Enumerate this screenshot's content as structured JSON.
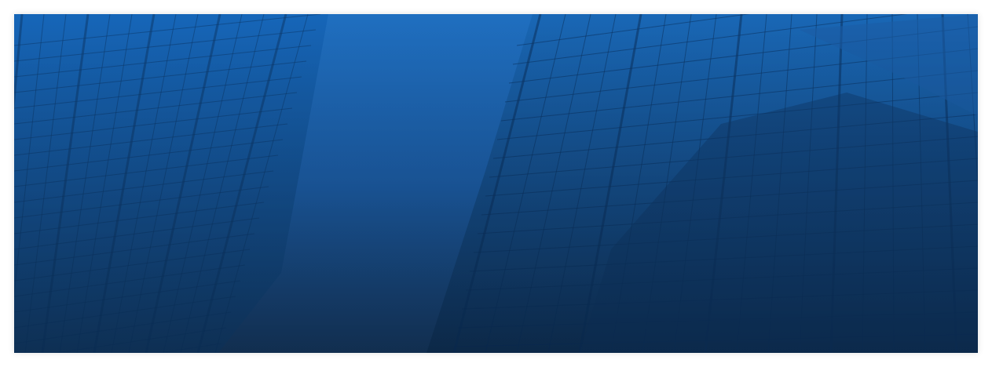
{
  "banner": {
    "image": "blue-tinted-skyscraper-glass-facades",
    "colors": {
      "top": "#1c6bbd",
      "bottom": "#163a63",
      "building_dark": "#0f3f78",
      "grid_line": "#0b3566"
    }
  }
}
